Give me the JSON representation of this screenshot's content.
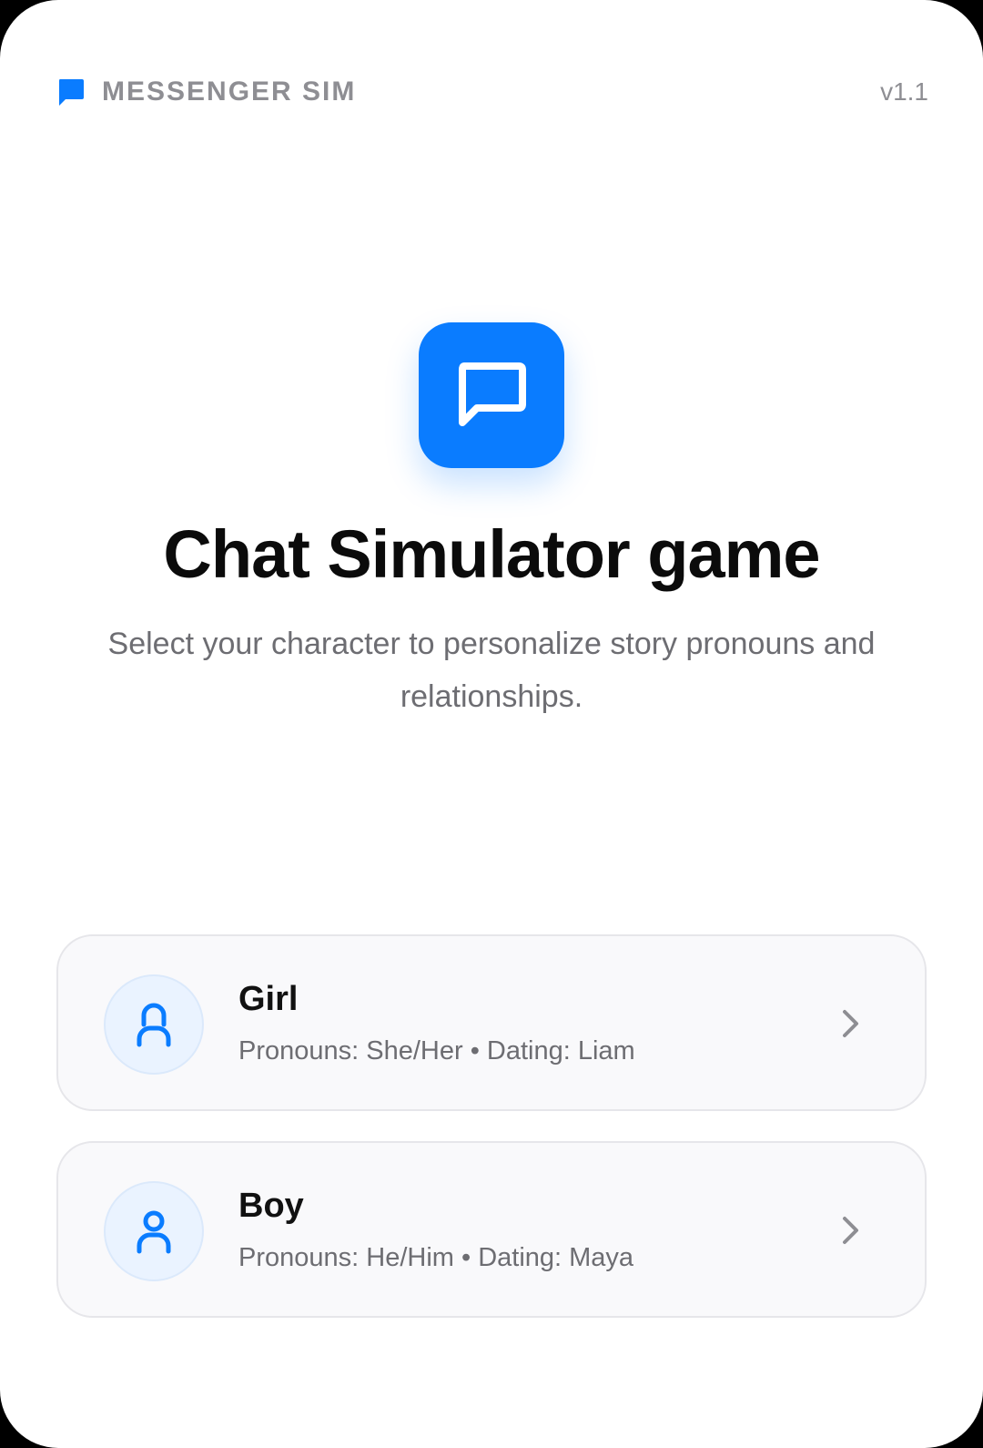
{
  "header": {
    "brand_icon": "chat-bubble-icon",
    "brand_name": "MESSENGER SIM",
    "version": "v1.1"
  },
  "hero": {
    "icon": "chat-bubble-icon",
    "title": "Chat Simulator game",
    "subtitle": "Select your character to personalize story pronouns and relationships."
  },
  "options": [
    {
      "icon": "person-icon",
      "title": "Girl",
      "description": "Pronouns: She/Her • Dating: Liam"
    },
    {
      "icon": "person-icon",
      "title": "Boy",
      "description": "Pronouns: He/Him • Dating: Maya"
    }
  ],
  "colors": {
    "accent": "#0a7cff",
    "muted_text": "#8e8e93",
    "card_border": "#e6e6ea",
    "card_background": "#f9f9fb",
    "avatar_background": "#eaf3ff"
  }
}
